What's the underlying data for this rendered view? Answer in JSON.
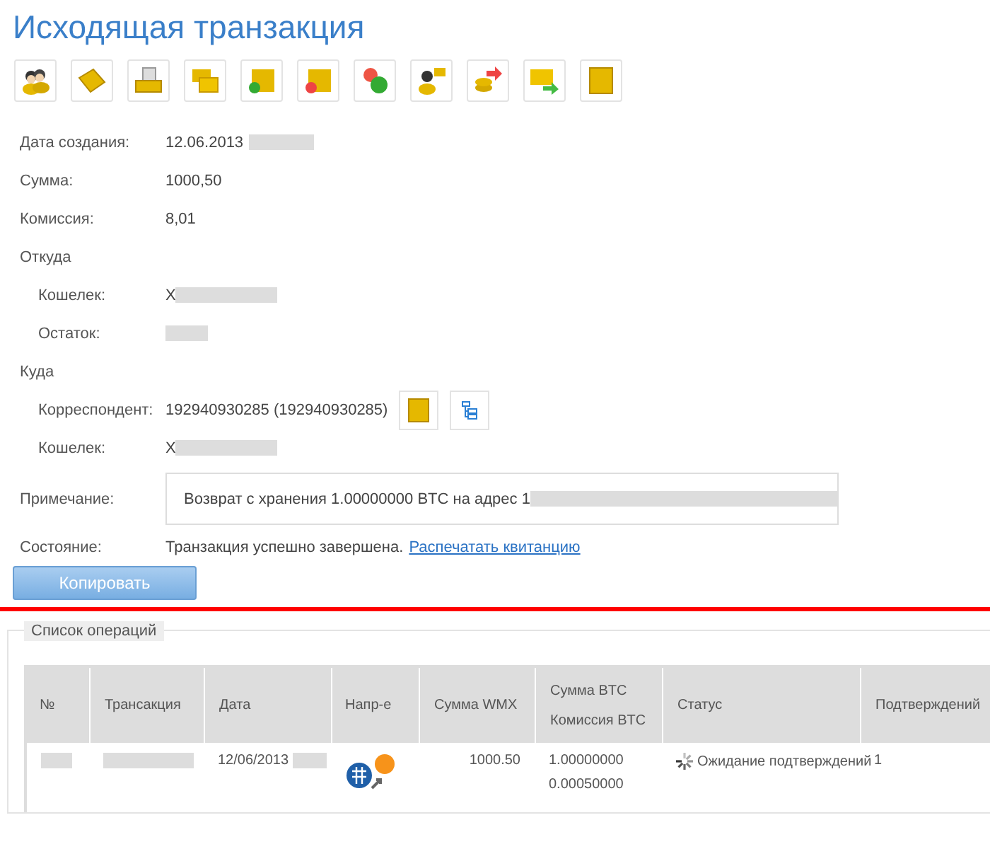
{
  "title": "Исходящая транзакция",
  "details": [
    {
      "label": "Дата создания:",
      "value": "12.06.2013",
      "redacted": true
    },
    {
      "label": "Сумма:",
      "value": "1000,50"
    },
    {
      "label": "Комиссия:",
      "value": "8,01"
    },
    {
      "label": "Откуда",
      "kind": "section",
      "children": [
        {
          "label": "Кошелек:",
          "value": "X",
          "redacted": true
        },
        {
          "label": "Остаток:",
          "redacted": true
        }
      ]
    },
    {
      "label": "Куда",
      "kind": "section",
      "children": [
        {
          "label": "Корреспондент:",
          "value": "192940930285 (192940930285)",
          "kind": "correspondent"
        },
        {
          "label": "Кошелек:",
          "value": "X",
          "redacted": true
        }
      ]
    }
  ],
  "note": {
    "label": "Примечание:",
    "value": "Возврат с хранения 1.00000000 BTC на адрес 1"
  },
  "state": {
    "label": "Состояние:",
    "value": "Транзакция успешно завершена.",
    "link": "Распечатать квитанцию"
  },
  "copy_button": "Копировать",
  "operations": {
    "legend": "Список операций",
    "columns": [
      "№",
      "Трансакция",
      "Дата",
      "Напр-е",
      "Сумма WMX",
      [
        "Сумма BTC",
        "Комиссия BTC"
      ],
      "Статус",
      "Подтверждений"
    ],
    "rows": [
      {
        "date": "12/06/2013",
        "amount_wmx": "1000.50",
        "amount_btc": "1.00000000",
        "fee_btc": "0.00050000",
        "status": "Ожидание подтверждений",
        "confirmations": "1"
      }
    ]
  }
}
